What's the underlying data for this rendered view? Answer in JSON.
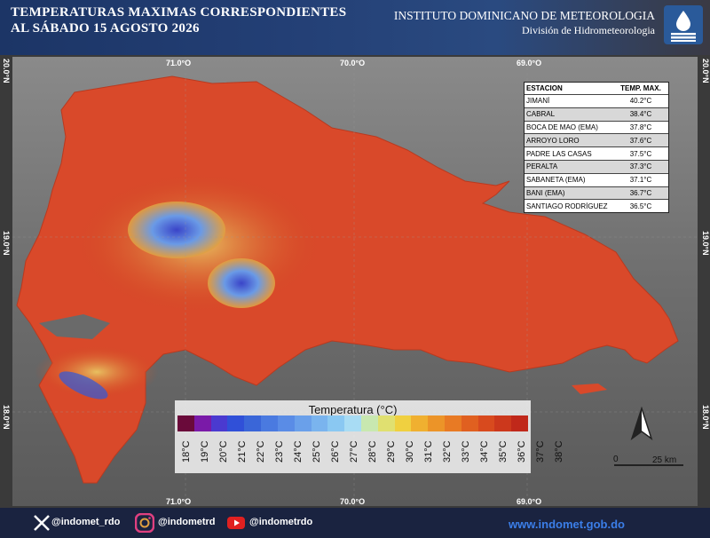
{
  "header": {
    "title_line1": "TEMPERATURAS MAXIMAS CORRESPONDIENTES",
    "title_line2": "AL SÁBADO 15  AGOSTO 2026",
    "institute": "INSTITUTO DOMINICANO DE METEOROLOGIA",
    "division": "División de Hidrometeorologia"
  },
  "axes": {
    "longitudes": [
      "71.0°O",
      "70.0°O",
      "69.0°O"
    ],
    "latitudes": [
      "20.0°N",
      "19.0°N",
      "18.0°N"
    ]
  },
  "stations": {
    "col_station": "ESTACION",
    "col_temp": "TEMP. MAX.",
    "rows": [
      {
        "name": "JIMANÍ",
        "temp": "40.2°C"
      },
      {
        "name": "CABRAL",
        "temp": "38.4°C"
      },
      {
        "name": "BOCA DE MAO (EMA)",
        "temp": "37.8°C"
      },
      {
        "name": "ARROYO LORO",
        "temp": "37.6°C"
      },
      {
        "name": "PADRE LAS CASAS",
        "temp": "37.5°C"
      },
      {
        "name": "PERALTA",
        "temp": "37.3°C"
      },
      {
        "name": "SABANETA (EMA)",
        "temp": "37.1°C"
      },
      {
        "name": "BANI (EMA)",
        "temp": "36.7°C"
      },
      {
        "name": "SANTIAGO RODRÍGUEZ",
        "temp": "36.5°C"
      }
    ]
  },
  "legend": {
    "title": "Temperatura (°C)",
    "labels": [
      "18°C",
      "19°C",
      "20°C",
      "21°C",
      "22°C",
      "23°C",
      "24°C",
      "25°C",
      "26°C",
      "27°C",
      "28°C",
      "29°C",
      "30°C",
      "31°C",
      "32°C",
      "33°C",
      "34°C",
      "35°C",
      "36°C",
      "37°C",
      "38°C"
    ],
    "colors": [
      "#6a0a3a",
      "#7a1aa8",
      "#4a3ad0",
      "#3050d8",
      "#3a66d8",
      "#4a7ae0",
      "#5a8ce6",
      "#6aa0ea",
      "#7ab4ee",
      "#8ac8f2",
      "#a8dcf4",
      "#c8e8b0",
      "#e0e070",
      "#f0d040",
      "#f0b030",
      "#ec9428",
      "#e87a24",
      "#e06020",
      "#d84a1e",
      "#cc381c",
      "#c0281a"
    ]
  },
  "scale": {
    "zero": "0",
    "distance": "25 km"
  },
  "north_label": "N",
  "footer": {
    "twitter": "@indomet_rdo",
    "instagram": "@indometrd",
    "youtube": "@indometrdo",
    "website": "www.indomet.gob.do"
  }
}
